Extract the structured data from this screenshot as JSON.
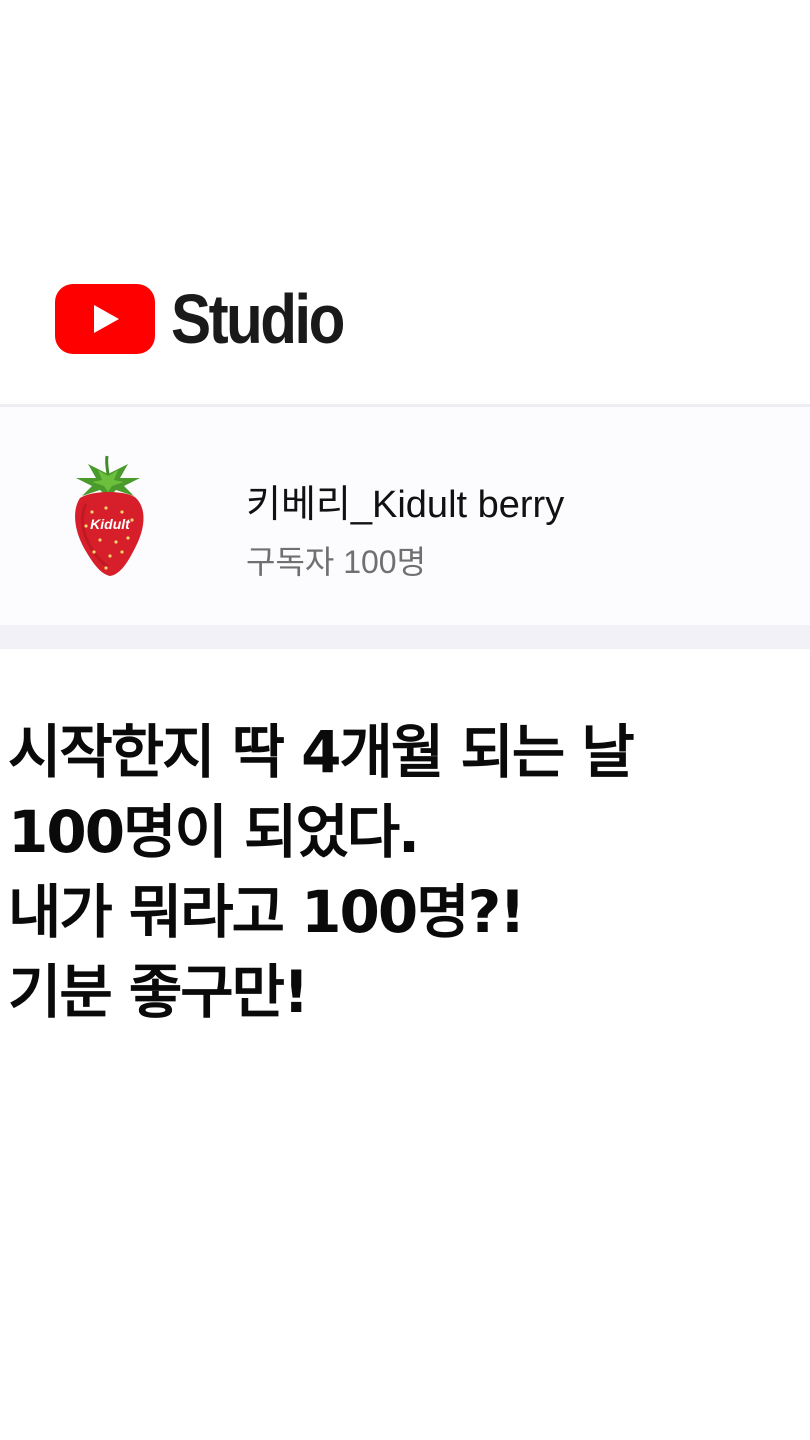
{
  "header": {
    "logo_text": "Studio",
    "logo_icon": "youtube-play-icon",
    "brand_color": "#ff0000"
  },
  "channel": {
    "name": "키베리_Kidult berry",
    "subscribers": "구독자 100명",
    "avatar_label": "Kidult"
  },
  "caption": {
    "lines": [
      "시작한지 딱 4개월 되는 날",
      "100명이 되었다.",
      "내가 뭐라고 100명?!",
      "기분 좋구만!"
    ]
  }
}
